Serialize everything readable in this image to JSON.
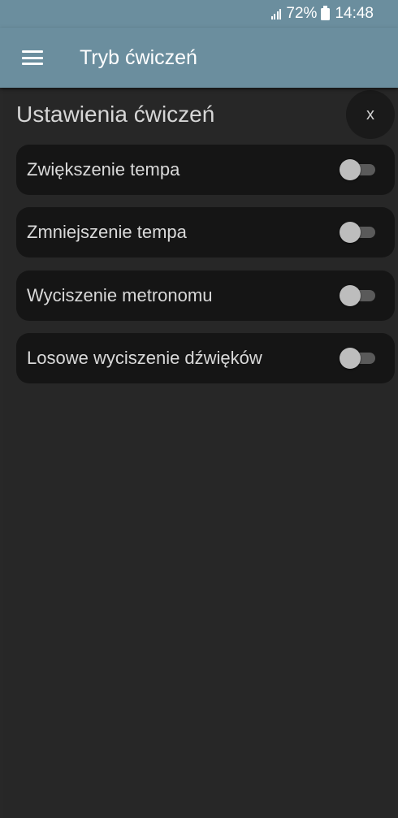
{
  "status_bar": {
    "battery": "72%",
    "time": "14:48"
  },
  "app_bar": {
    "title": "Tryb ćwiczeń"
  },
  "settings_panel": {
    "title": "Ustawienia ćwiczeń",
    "close_label": "x",
    "items": [
      {
        "label": "Zwiększenie tempa",
        "enabled": false
      },
      {
        "label": "Zmniejszenie tempa",
        "enabled": false
      },
      {
        "label": "Wyciszenie metronomu",
        "enabled": false
      },
      {
        "label": "Losowe wyciszenie dźwięków",
        "enabled": false
      }
    ]
  },
  "colors": {
    "app_bar": "#6b8e9e",
    "background": "#282828",
    "row_background": "#151515",
    "toggle_thumb": "#bdbdbd",
    "toggle_track": "#5a5a5a"
  }
}
